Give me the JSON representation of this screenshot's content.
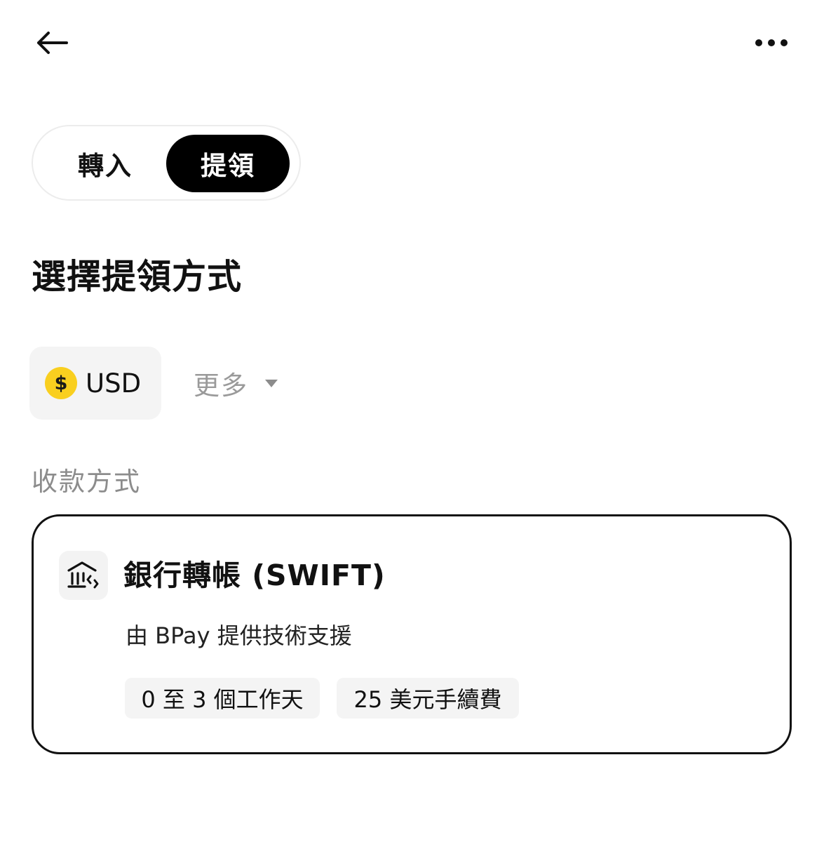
{
  "header": {
    "back_icon": "arrow-left-icon",
    "more_icon": "more-horizontal-icon"
  },
  "tabs": {
    "deposit_label": "轉入",
    "withdraw_label": "提領",
    "active": "withdraw"
  },
  "page": {
    "title": "選擇提領方式"
  },
  "currency": {
    "selected_symbol": "$",
    "selected_code": "USD",
    "coin_color": "#f9cf1f",
    "more_label": "更多",
    "more_icon": "caret-down-icon"
  },
  "payment_section": {
    "label": "收款方式",
    "methods": [
      {
        "icon": "bank-transfer-icon",
        "name": "銀行轉帳 (SWIFT)",
        "provider_text": "由 BPay 提供技術支援",
        "tags": [
          "0 至 3 個工作天",
          "25 美元手續費"
        ]
      }
    ]
  }
}
